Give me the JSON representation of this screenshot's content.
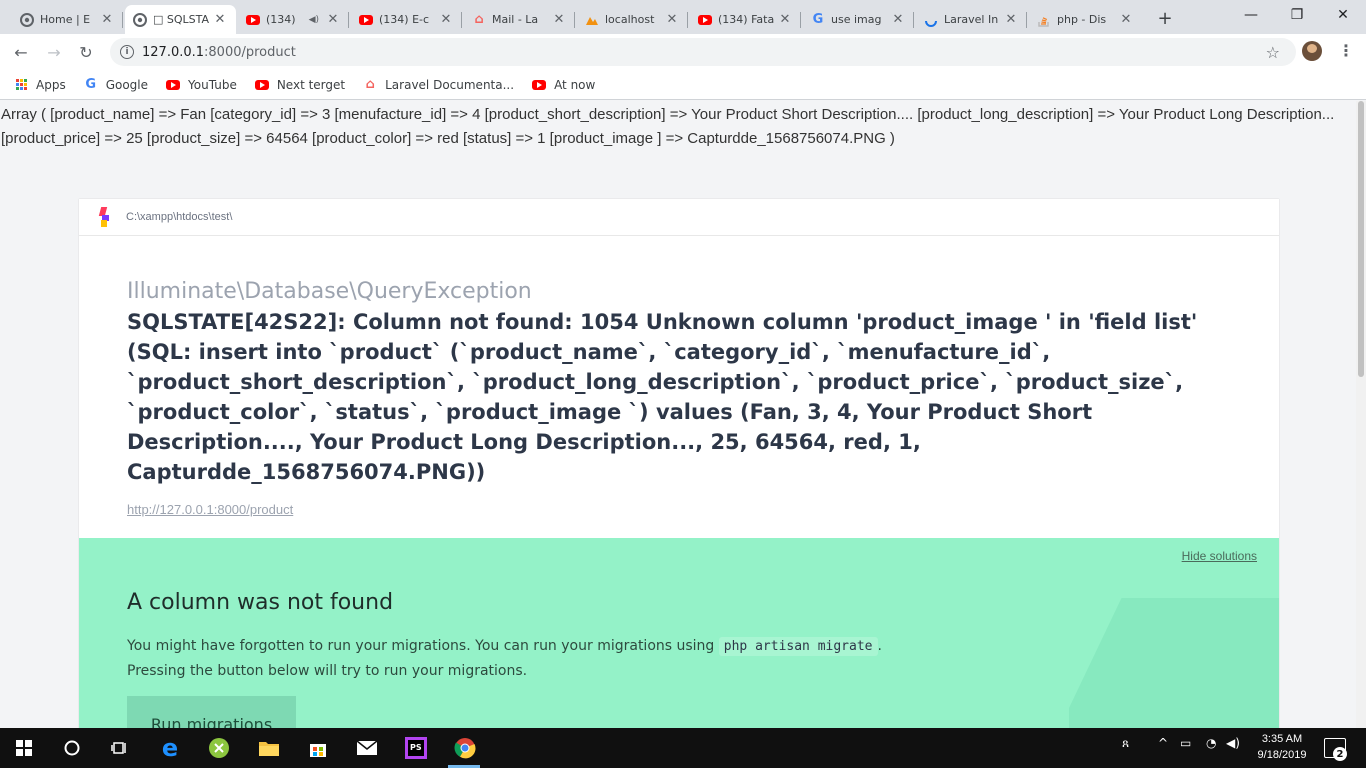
{
  "browser": {
    "tabs": [
      {
        "title": "Home | E",
        "icon": "chrome-icon"
      },
      {
        "title": "□ SQLSTA",
        "icon": "chrome-icon",
        "active": true
      },
      {
        "title": "(134)",
        "icon": "youtube-icon",
        "audio": "◀)"
      },
      {
        "title": "(134) E-c",
        "icon": "youtube-icon"
      },
      {
        "title": "Mail - La",
        "icon": "laravel-icon"
      },
      {
        "title": "localhost",
        "icon": "phpmyadmin-icon"
      },
      {
        "title": "(134) Fata",
        "icon": "youtube-icon"
      },
      {
        "title": "use imag",
        "icon": "google-icon"
      },
      {
        "title": "Laravel In",
        "icon": "loading-icon"
      },
      {
        "title": "php - Dis",
        "icon": "stackoverflow-icon"
      }
    ],
    "url_host": "127.0.0.1",
    "url_path": ":8000/product",
    "bookmarks": [
      {
        "label": "Apps",
        "icon": "apps-grid-icon"
      },
      {
        "label": "Google",
        "icon": "google-icon"
      },
      {
        "label": "YouTube",
        "icon": "youtube-icon"
      },
      {
        "label": "Next terget",
        "icon": "youtube-icon"
      },
      {
        "label": "Laravel Documenta...",
        "icon": "laravel-icon"
      },
      {
        "label": "At now",
        "icon": "youtube-icon"
      }
    ]
  },
  "page": {
    "dump_text": "Array ( [product_name] => Fan [category_id] => 3 [menufacture_id] => 4 [product_short_description] => Your Product Short Description.... [product_long_description] => Your Product Long Description... [product_price] => 25 [product_size] => 64564 [product_color] => red [status] => 1 [product_image ] => Capturdde_1568756074.PNG )",
    "app_path": "C:\\xampp\\htdocs\\test\\",
    "exception_ns1": "Illuminate",
    "exception_ns2": "Database",
    "exception_class": "QueryException",
    "exception_sep": "\\",
    "exception_message": "SQLSTATE[42S22]: Column not found: 1054 Unknown column 'product_image ' in 'field list' (SQL: insert into `product` (`product_name`, `category_id`, `menufacture_id`, `product_short_description`, `product_long_description`, `product_price`, `product_size`, `product_color`, `status`, `product_image `) values (Fan, 3, 4, Your Product Short Description...., Your Product Long Description..., 25, 64564, red, 1, Capturdde_1568756074.PNG))",
    "exception_url": "http://127.0.0.1:8000/product",
    "solution": {
      "hide_label": "Hide solutions",
      "title": "A column was not found",
      "desc_part1": "You might have forgotten to run your migrations. You can run your migrations using ",
      "desc_code": "php artisan migrate",
      "desc_part2": ".",
      "desc_line2": "Pressing the button below will try to run your migrations.",
      "button_label": "Run migrations"
    }
  },
  "taskbar": {
    "time": "3:35 AM",
    "date": "9/18/2019",
    "notifications": "2"
  },
  "colors": {
    "solution_bg": "#94f2c8",
    "message_text": "#2d3748"
  }
}
